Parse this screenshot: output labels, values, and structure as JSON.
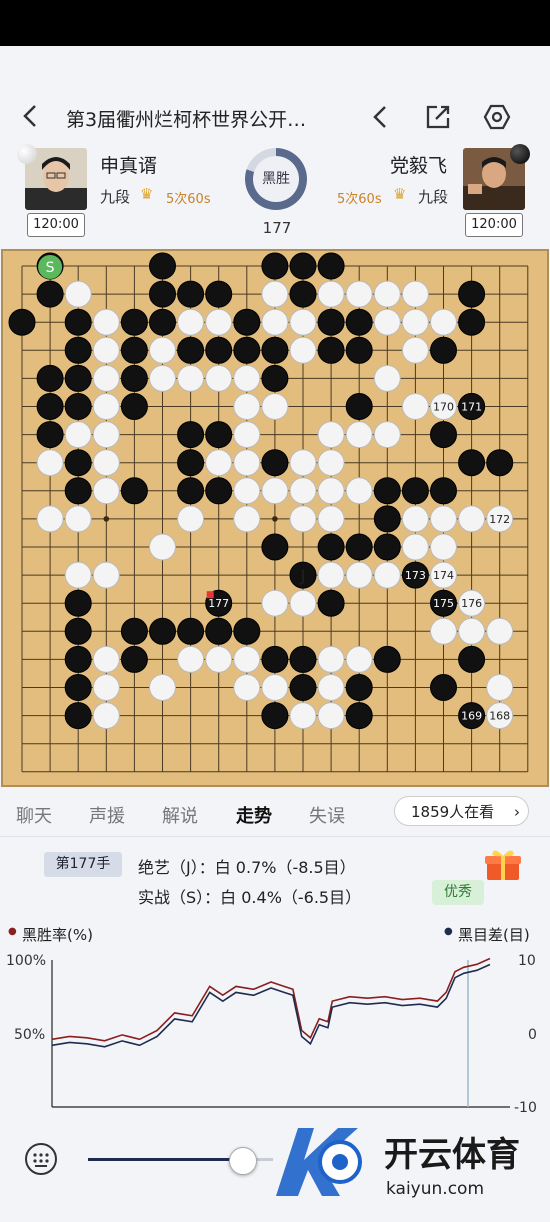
{
  "header": {
    "title": "第3届衢州烂柯杯世界公开…"
  },
  "black_player": {
    "name": "申真谞",
    "rank": "九段",
    "byoyomi": "5次60s",
    "clock": "120:00"
  },
  "white_player": {
    "name": "党毅飞",
    "rank": "九段",
    "byoyomi": "5次60s",
    "clock": "120:00"
  },
  "result": {
    "label": "黑胜",
    "move_number": "177"
  },
  "tabs": [
    "聊天",
    "声援",
    "解说",
    "走势",
    "失误"
  ],
  "active_tab": "走势",
  "viewers": "1859人在看",
  "analysis": {
    "move_badge": "第177手",
    "line1": "绝艺（J）：白 0.7%（-8.5目）",
    "line2": "实战（S）：白 0.4%（-6.5目）",
    "rating": "优秀"
  },
  "graph": {
    "left_label": "黑胜率(%)",
    "right_label": "黑目差(目)",
    "y_left_ticks": [
      "100%",
      "50%"
    ],
    "y_right_ticks": [
      "10",
      "0",
      "-10"
    ],
    "series_colors": {
      "winrate": "#8a1f1f",
      "score": "#1e2d4f"
    }
  },
  "watermark": {
    "brand": "开云体育",
    "url": "kaiyun.com"
  },
  "board": {
    "marks": {
      "S": "S",
      "J": "J"
    },
    "numbered": [
      {
        "n": "168",
        "color": "W"
      },
      {
        "n": "169",
        "color": "B"
      },
      {
        "n": "170",
        "color": "W"
      },
      {
        "n": "171",
        "color": "B"
      },
      {
        "n": "172",
        "color": "W"
      },
      {
        "n": "173",
        "color": "B"
      },
      {
        "n": "174",
        "color": "W"
      },
      {
        "n": "175",
        "color": "B"
      },
      {
        "n": "176",
        "color": "W"
      },
      {
        "n": "177",
        "color": "B"
      }
    ]
  },
  "colors": {
    "board": "#e2bd7d",
    "accent": "#5a6a8c",
    "last_move_marker": "#e53935"
  }
}
